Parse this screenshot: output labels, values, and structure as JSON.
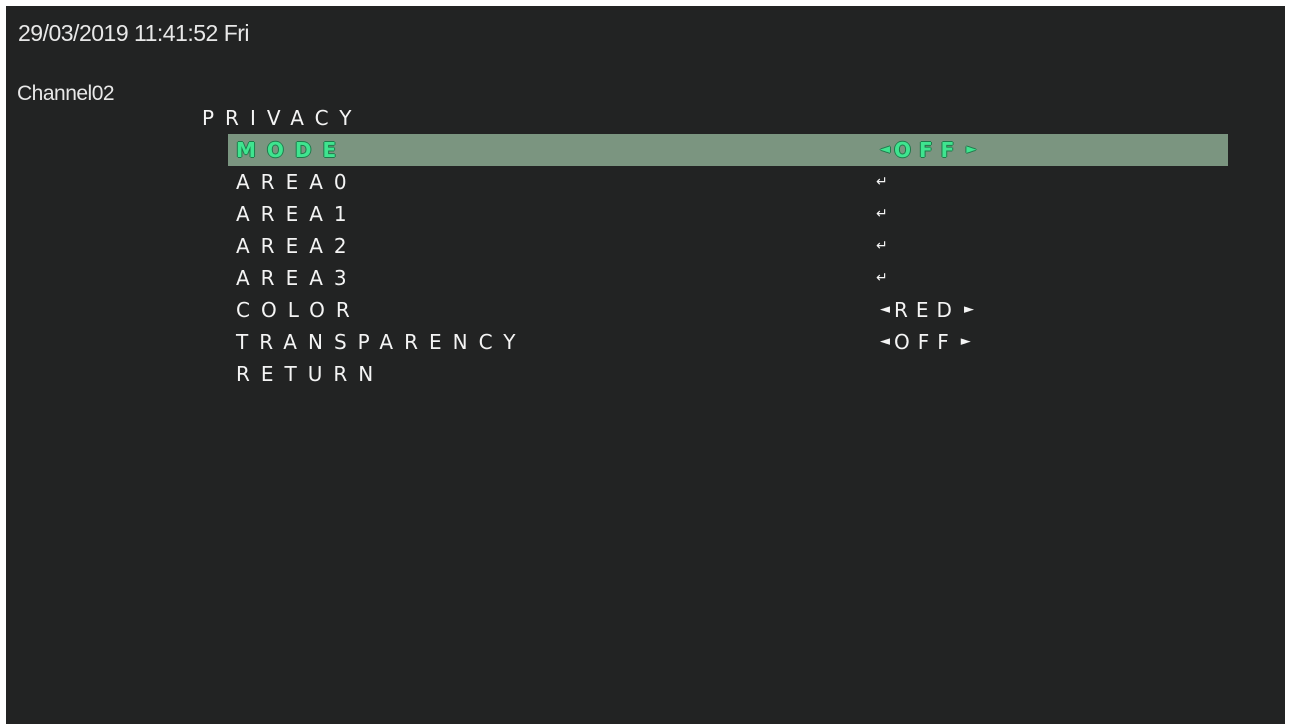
{
  "header": {
    "timestamp": "29/03/2019 11:41:52 Fri",
    "channel": "Channel02"
  },
  "menu": {
    "title": "PRIVACY",
    "items": [
      {
        "label": "MODE",
        "value": "OFF",
        "value_type": "selector",
        "selected": true
      },
      {
        "label": "AREA0",
        "value": "↵",
        "value_type": "enter"
      },
      {
        "label": "AREA1",
        "value": "↵",
        "value_type": "enter"
      },
      {
        "label": "AREA2",
        "value": "↵",
        "value_type": "enter"
      },
      {
        "label": "AREA3",
        "value": "↵",
        "value_type": "enter"
      },
      {
        "label": "COLOR",
        "value": "RED",
        "value_type": "selector"
      },
      {
        "label": "TRANSPARENCY",
        "value": "OFF",
        "value_type": "selector"
      },
      {
        "label": "RETURN",
        "value": "",
        "value_type": "none"
      }
    ]
  },
  "icons": {
    "left_arrow": "left-triangle-icon",
    "right_arrow": "right-triangle-icon",
    "enter": "enter-return-icon"
  },
  "colors": {
    "background": "#222323",
    "highlight_bar": "#7b9580",
    "highlight_text": "#3fe48f",
    "text": "#f4f4f4"
  }
}
